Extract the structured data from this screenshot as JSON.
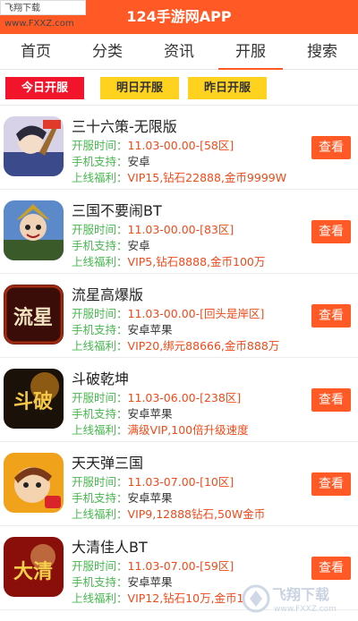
{
  "watermark_top": "飞翔下载 www.FXXZ.com",
  "app_title": "124手游网APP",
  "nav": {
    "tabs": [
      {
        "label": "首页"
      },
      {
        "label": "分类"
      },
      {
        "label": "资讯"
      },
      {
        "label": "开服"
      },
      {
        "label": "搜索"
      }
    ],
    "active": "开服"
  },
  "subtabs": [
    {
      "label": "今日开服"
    },
    {
      "label": "明日开服"
    },
    {
      "label": "昨日开服"
    }
  ],
  "labels": {
    "time": "开服时间：",
    "sys": "手机支持：",
    "perk": "上线福利：",
    "action": "查看"
  },
  "games": [
    {
      "name": "三十六策-无限版",
      "time": "11.03-00.00-[58区]",
      "sys": "安卓",
      "perk": "VIP15,钻石22888,金币9999W",
      "icon": "game-icon-36ce",
      "icon_text": ""
    },
    {
      "name": "三国不要闹BT",
      "time": "11.03-00.00-[83区]",
      "sys": "安卓",
      "perk": "VIP5,钻石8888,金币100万",
      "icon": "game-icon-sanguo",
      "icon_text": ""
    },
    {
      "name": "流星高爆版",
      "time": "11.03-00.00-[回头是岸区]",
      "sys": "安卓苹果",
      "perk": "VIP20,绑元88666,金币888万",
      "icon": "game-icon-liuxing",
      "icon_text": "流星"
    },
    {
      "name": "斗破乾坤",
      "time": "11.03-06.00-[238区]",
      "sys": "安卓苹果",
      "perk": "满级VIP,100倍升级速度",
      "icon": "game-icon-doupo",
      "icon_text": "斗破"
    },
    {
      "name": "天天弹三国",
      "time": "11.03-07.00-[10区]",
      "sys": "安卓苹果",
      "perk": "VIP9,12888钻石,50W金币",
      "icon": "game-icon-tiantian",
      "icon_text": ""
    },
    {
      "name": "大清佳人BT",
      "time": "11.03-07.00-[59区]",
      "sys": "安卓苹果",
      "perk": "VIP12,钻石10万,金币1",
      "icon": "game-icon-daqing",
      "icon_text": "大清"
    }
  ],
  "watermark_bottom": {
    "main": "飞翔下载",
    "sub": "www.FXXZ.com"
  },
  "colors": {
    "accent": "#ff5a26",
    "today": "#f2142a",
    "yellow": "#ffd21f",
    "label_green": "#48b84f",
    "value_red": "#f04a1a"
  }
}
